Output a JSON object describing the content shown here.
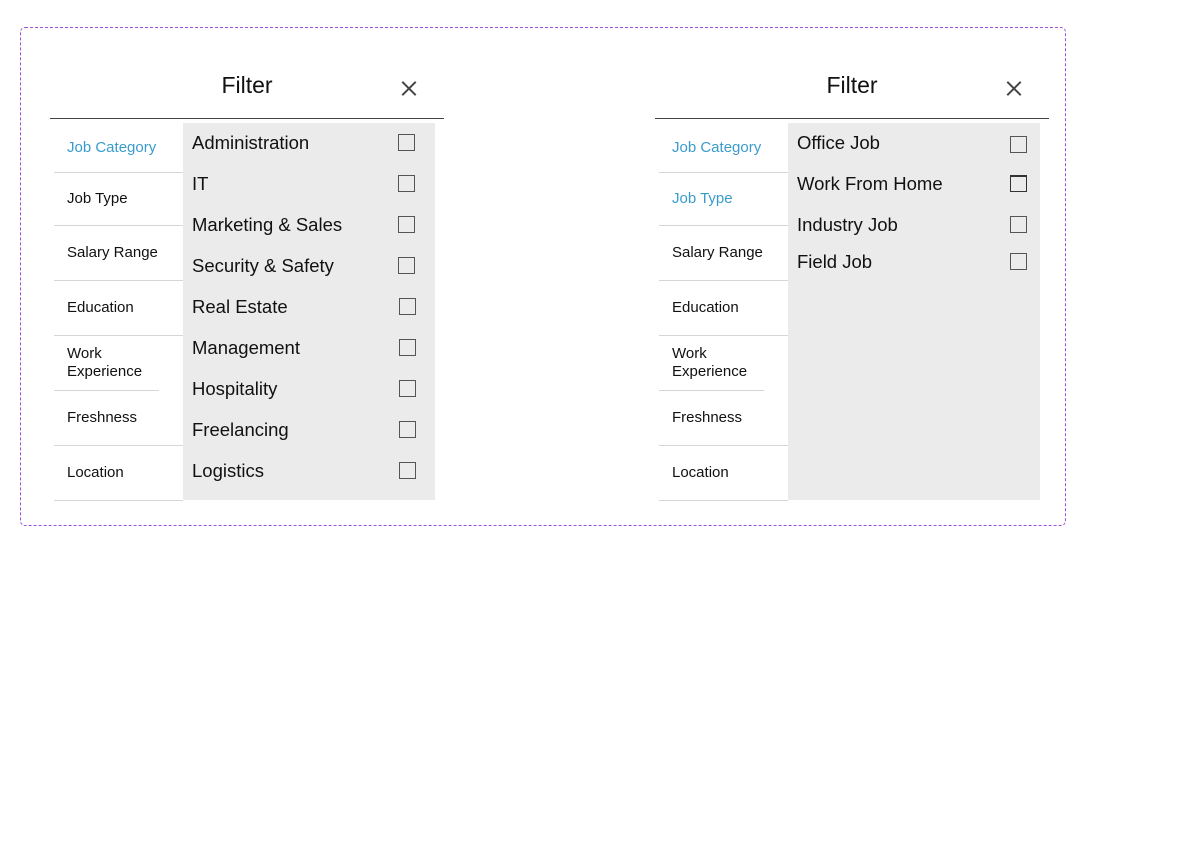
{
  "left_panel": {
    "title": "Filter",
    "close_icon": "close-icon",
    "categories": [
      {
        "label": "Job Category",
        "active": true
      },
      {
        "label": "Job Type",
        "active": false
      },
      {
        "label": "Salary Range",
        "active": false
      },
      {
        "label": "Education",
        "active": false
      },
      {
        "label": "Work Experience",
        "active": false
      },
      {
        "label": "Freshness",
        "active": false
      },
      {
        "label": "Location",
        "active": false
      }
    ],
    "options": [
      {
        "label": "Administration",
        "checked": false
      },
      {
        "label": "IT",
        "checked": false
      },
      {
        "label": "Marketing & Sales",
        "checked": false
      },
      {
        "label": "Security & Safety",
        "checked": false
      },
      {
        "label": "Real Estate",
        "checked": false
      },
      {
        "label": "Management",
        "checked": false
      },
      {
        "label": "Hospitality",
        "checked": false
      },
      {
        "label": "Freelancing",
        "checked": false
      },
      {
        "label": "Logistics",
        "checked": false
      }
    ]
  },
  "right_panel": {
    "title": "Filter",
    "close_icon": "close-icon",
    "categories": [
      {
        "label": "Job Category",
        "active": true
      },
      {
        "label": "Job Type",
        "active": true
      },
      {
        "label": "Salary Range",
        "active": false
      },
      {
        "label": "Education",
        "active": false
      },
      {
        "label": "Work Experience",
        "active": false
      },
      {
        "label": "Freshness",
        "active": false
      },
      {
        "label": "Location",
        "active": false
      }
    ],
    "options": [
      {
        "label": "Office Job",
        "checked": false
      },
      {
        "label": "Work From Home",
        "checked": false
      },
      {
        "label": "Industry Job",
        "checked": false
      },
      {
        "label": "Field Job",
        "checked": false
      }
    ]
  },
  "colors": {
    "accent": "#3a9ccc",
    "options_background": "#ebebeb",
    "frame_border": "#9b51e0"
  }
}
